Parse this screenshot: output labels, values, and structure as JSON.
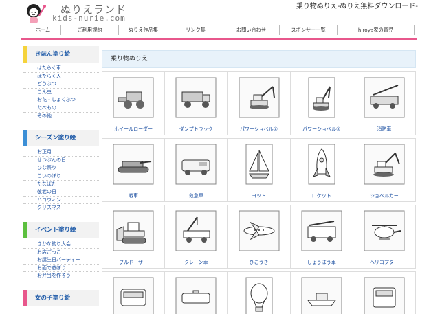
{
  "header": {
    "logo_title": "ぬりえランド",
    "logo_sub": "kids-nurie.com",
    "tagline": "乗り物ぬりえ-ぬりえ無料ダウンロード-"
  },
  "nav": [
    "ホーム",
    "ご利用規約",
    "ぬりえ作品集",
    "リンク集",
    "お問い合わせ",
    "スポンサー一覧",
    "hiroya家の育児"
  ],
  "sidebar": [
    {
      "title": "きほん塗り絵",
      "color": "yellow",
      "items": [
        "はたらく車",
        "はたらく人",
        "どうぶつ",
        "こん虫",
        "お花・しょくぶつ",
        "たべもの",
        "その他"
      ]
    },
    {
      "title": "シーズン塗り絵",
      "color": "blue",
      "items": [
        "お正月",
        "せつぶんの日",
        "ひな祭り",
        "こいのぼり",
        "たなばた",
        "敬老の日",
        "ハロウィン",
        "クリスマス"
      ]
    },
    {
      "title": "イベント塗り絵",
      "color": "green",
      "items": [
        "さかな釣り大会",
        "お店ごっこ",
        "お誕生日パーティー",
        "お面で遊ぼう",
        "お弁当を作ろう"
      ]
    },
    {
      "title": "女の子塗り絵",
      "color": "pink",
      "items": []
    }
  ],
  "content": {
    "title": "乗り物ぬりえ",
    "rows": [
      [
        "ホイールローダー",
        "ダンプトラック",
        "パワーショベル①",
        "パワーショベル②",
        "消防車"
      ],
      [
        "戦車",
        "救急車",
        "ヨット",
        "ロケット",
        "ショベルカー"
      ],
      [
        "ブルドーザー",
        "クレーン車",
        "ひこうき",
        "しょうぼう車",
        "ヘリコプター"
      ]
    ],
    "partial_row_icons": [
      "bus-icon",
      "police-car-icon",
      "balloon-icon",
      "ship-icon",
      "train-icon"
    ]
  },
  "colors": {
    "accent_pink": "#e8578c",
    "link_blue": "#1a4ea0",
    "heading_blue": "#1e5aa8"
  }
}
